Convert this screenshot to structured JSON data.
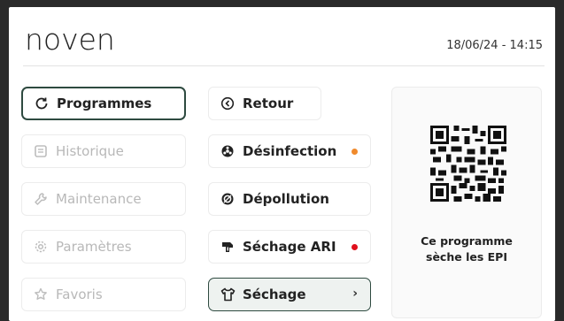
{
  "header": {
    "logo": "noven",
    "datetime": "18/06/24 - 14:15"
  },
  "left_menu": [
    {
      "label": "Programmes",
      "icon": "refresh-icon",
      "active": true
    },
    {
      "label": "Historique",
      "icon": "history-icon",
      "active": false
    },
    {
      "label": "Maintenance",
      "icon": "wrench-icon",
      "active": false
    },
    {
      "label": "Paramètres",
      "icon": "gear-icon",
      "active": false
    },
    {
      "label": "Favoris",
      "icon": "star-icon",
      "active": false
    }
  ],
  "program_menu": [
    {
      "label": "Retour",
      "icon": "back-icon"
    },
    {
      "label": "Désinfection",
      "icon": "biohazard-icon",
      "status_color": "#f08a2c"
    },
    {
      "label": "Dépollution",
      "icon": "filter-icon"
    },
    {
      "label": "Séchage ARI",
      "icon": "mask-icon",
      "status_color": "#e0101c"
    },
    {
      "label": "Séchage",
      "icon": "shirt-icon",
      "selected": true,
      "chevron": "›"
    }
  ],
  "info_panel": {
    "qr_icon": "qr-code-icon",
    "line1": "Ce programme",
    "line2": "sèche les EPI"
  }
}
